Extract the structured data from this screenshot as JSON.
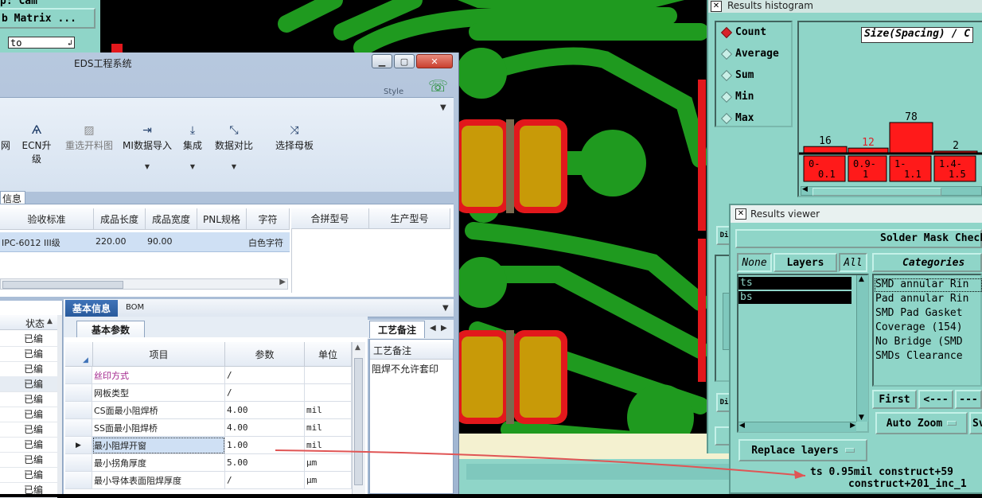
{
  "background": {
    "left_top_panel": {
      "label": "b Matrix ...",
      "partial_label": "p: Cam",
      "input_value": "to"
    }
  },
  "eds": {
    "title": "EDS工程系统",
    "style_label": "Style",
    "window_buttons": {
      "minimize": "▁",
      "maximize": "▢",
      "close": "✕"
    },
    "toolbar": [
      {
        "label": "网",
        "icon": ""
      },
      {
        "label": "ECN升级",
        "icon": "Ѧ"
      },
      {
        "label": "重选开料图",
        "icon": "▨"
      },
      {
        "label": "MI数据导入",
        "icon": "⇥"
      },
      {
        "label": "集成",
        "icon": "⤓"
      },
      {
        "label": "数据对比",
        "icon": "⤡"
      },
      {
        "label": "选择母板",
        "icon": "⤨"
      }
    ],
    "section_tab": "信息",
    "top_table": {
      "headers": [
        "验收标准",
        "成品长度",
        "成品宽度",
        "PNL规格",
        "字符"
      ],
      "row": [
        "IPC-6012 III级",
        "220.00",
        "90.00",
        "",
        "白色字符"
      ],
      "right_headers": [
        "合拼型号",
        "生产型号"
      ]
    },
    "left_list": {
      "header": "状态",
      "items": [
        "已编",
        "已编",
        "已编",
        "已编",
        "已编",
        "已编",
        "已编",
        "已编",
        "已编",
        "已编",
        "已编"
      ]
    },
    "bottom_tabs": [
      "基本信息",
      "BOM"
    ],
    "sub_tab": "基本参数",
    "params_table": {
      "headers": [
        "项目",
        "参数",
        "单位"
      ],
      "rows": [
        {
          "item": "丝印方式",
          "value": "/",
          "unit": ""
        },
        {
          "item": "网板类型",
          "value": "/",
          "unit": ""
        },
        {
          "item": "CS面最小阻焊桥",
          "value": "4.00",
          "unit": "mil"
        },
        {
          "item": "SS面最小阻焊桥",
          "value": "4.00",
          "unit": "mil"
        },
        {
          "item": "最小阻焊开窗",
          "value": "1.00",
          "unit": "mil"
        },
        {
          "item": "最小拐角厚度",
          "value": "5.00",
          "unit": "μm"
        },
        {
          "item": "最小导体表面阻焊厚度",
          "value": "/",
          "unit": "μm"
        }
      ]
    },
    "process_tab": "工艺备注",
    "process_header": "工艺备注",
    "process_note": "阻焊不允许套印"
  },
  "histogram": {
    "title": "Results histogram",
    "options": [
      "Count",
      "Average",
      "Sum",
      "Min",
      "Max"
    ],
    "selected": "Count",
    "axis_title": "Size(Spacing) / C",
    "chart_data": {
      "type": "bar",
      "categories": [
        "0-0.1",
        "0.9-1",
        "1-1.1",
        "1.4-1.5"
      ],
      "bin_labels": [
        [
          "0-",
          "0.1"
        ],
        [
          "0.9-",
          "1"
        ],
        [
          "1-",
          "1.1"
        ],
        [
          "1.4-",
          "1.5"
        ]
      ],
      "values": [
        16,
        12,
        78,
        2
      ],
      "highlight_index": 1,
      "colors": {
        "bar": "#ff1a1a",
        "highlight_label": "#d8232a"
      }
    }
  },
  "viewer": {
    "title": "Results viewer",
    "header": "Solder Mask Checks",
    "layer_buttons": [
      "None",
      "Layers",
      "All"
    ],
    "layers": [
      "ts",
      "bs"
    ],
    "categories_title": "Categories",
    "categories": [
      "SMD annular Rin",
      "Pad annular Rin",
      "SMD Pad Gasket",
      "Coverage (154)",
      "No Bridge (SMD",
      "SMDs Clearance"
    ],
    "nav_buttons": [
      "First",
      "<---",
      "---"
    ],
    "auto_zoom": "Auto Zoom",
    "partial_button": "Sv",
    "replace_layers": "Replace layers",
    "status_line1": "ts 0.95mil  construct+59",
    "status_line2": "construct+201_inc_1"
  }
}
